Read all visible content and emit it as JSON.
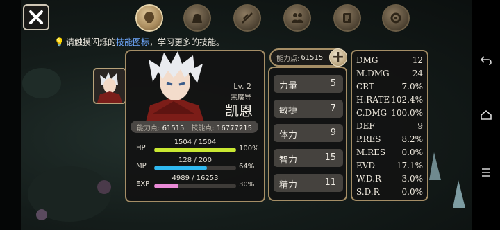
{
  "top_bar": {
    "close_icon": "close-icon",
    "tabs": [
      {
        "icon": "character-head-icon",
        "active": true
      },
      {
        "icon": "bag-icon",
        "active": false
      },
      {
        "icon": "feather-skill-icon",
        "active": false
      },
      {
        "icon": "party-icon",
        "active": false
      },
      {
        "icon": "scroll-icon",
        "active": false
      },
      {
        "icon": "gear-icon",
        "active": false
      }
    ]
  },
  "hint": {
    "prefix": "请触摸闪烁的",
    "highlight": "技能图标",
    "suffix": "，学习更多的技能。",
    "highlight_color": "#6fa9ff"
  },
  "character": {
    "level": "Lv. 2",
    "class": "黑魔导",
    "name": "凯恩",
    "ability_points_label": "能力点:",
    "ability_points": "61515",
    "skill_points_label": "技能点:",
    "skill_points": "16777215",
    "bars": [
      {
        "key": "HP",
        "value": "1504 / 1504",
        "percent": "100%",
        "fraction": 1.0,
        "color": "#c9e832"
      },
      {
        "key": "MP",
        "value": "128 / 200",
        "percent": "64%",
        "fraction": 0.64,
        "color": "#2fb8f0"
      },
      {
        "key": "EXP",
        "value": "4989 / 16253",
        "percent": "30%",
        "fraction": 0.3,
        "color": "#e98ad6"
      }
    ]
  },
  "ability_panel": {
    "label": "能力点:",
    "value": "61515",
    "plus_label": "+",
    "attributes": [
      {
        "name": "力量",
        "value": "5"
      },
      {
        "name": "敏捷",
        "value": "7"
      },
      {
        "name": "体力",
        "value": "9"
      },
      {
        "name": "智力",
        "value": "15"
      },
      {
        "name": "精力",
        "value": "11"
      }
    ]
  },
  "stats": [
    {
      "key": "DMG",
      "value": "12"
    },
    {
      "key": "M.DMG",
      "value": "24"
    },
    {
      "key": "CRT",
      "value": "7.0%"
    },
    {
      "key": "H.RATE",
      "value": "102.4%"
    },
    {
      "key": "C.DMG",
      "value": "100.0%"
    },
    {
      "key": "DEF",
      "value": "9"
    },
    {
      "key": "P.RES",
      "value": "8.2%"
    },
    {
      "key": "M.RES",
      "value": "0.0%"
    },
    {
      "key": "EVD",
      "value": "17.1%"
    },
    {
      "key": "W.D.R",
      "value": "3.0%"
    },
    {
      "key": "S.D.R",
      "value": "0.0%"
    }
  ],
  "system_nav": [
    "back-icon",
    "home-icon",
    "menu-icon"
  ]
}
